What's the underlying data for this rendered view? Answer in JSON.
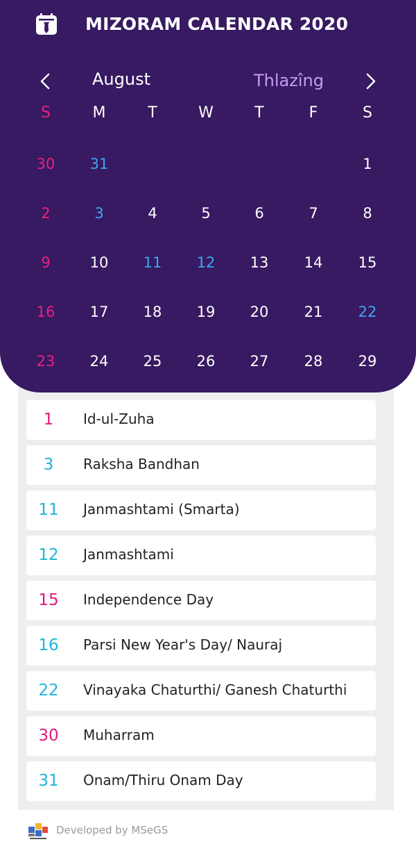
{
  "header": {
    "title": "MIZORAM CALENDAR 2020",
    "icon": "calendar-app-icon"
  },
  "nav": {
    "month": "August",
    "mizo_month": "Thlazîng",
    "prev_icon": "chevron-left-icon",
    "next_icon": "chevron-right-icon"
  },
  "weekdays": [
    "S",
    "M",
    "T",
    "W",
    "T",
    "F",
    "S"
  ],
  "weeks": [
    [
      {
        "d": "30",
        "t": "sunday"
      },
      {
        "d": "31",
        "t": "holiday"
      },
      null,
      null,
      null,
      null,
      {
        "d": "1",
        "t": "normal"
      }
    ],
    [
      {
        "d": "2",
        "t": "sunday"
      },
      {
        "d": "3",
        "t": "holiday"
      },
      {
        "d": "4",
        "t": "normal"
      },
      {
        "d": "5",
        "t": "normal"
      },
      {
        "d": "6",
        "t": "normal"
      },
      {
        "d": "7",
        "t": "normal"
      },
      {
        "d": "8",
        "t": "normal"
      }
    ],
    [
      {
        "d": "9",
        "t": "sunday"
      },
      {
        "d": "10",
        "t": "normal"
      },
      {
        "d": "11",
        "t": "holiday"
      },
      {
        "d": "12",
        "t": "holiday"
      },
      {
        "d": "13",
        "t": "normal"
      },
      {
        "d": "14",
        "t": "normal"
      },
      {
        "d": "15",
        "t": "normal"
      }
    ],
    [
      {
        "d": "16",
        "t": "sunday"
      },
      {
        "d": "17",
        "t": "normal"
      },
      {
        "d": "18",
        "t": "normal"
      },
      {
        "d": "19",
        "t": "normal"
      },
      {
        "d": "20",
        "t": "normal"
      },
      {
        "d": "21",
        "t": "normal"
      },
      {
        "d": "22",
        "t": "holiday"
      }
    ],
    [
      {
        "d": "23",
        "t": "sunday"
      },
      {
        "d": "24",
        "t": "normal"
      },
      {
        "d": "25",
        "t": "normal"
      },
      {
        "d": "26",
        "t": "normal"
      },
      {
        "d": "27",
        "t": "normal"
      },
      {
        "d": "28",
        "t": "normal"
      },
      {
        "d": "29",
        "t": "normal"
      }
    ]
  ],
  "holidays": [
    {
      "day": "1",
      "name": "Id-ul-Zuha",
      "color": "#e3177a"
    },
    {
      "day": "3",
      "name": "Raksha Bandhan",
      "color": "#1fb5d6"
    },
    {
      "day": "11",
      "name": "Janmashtami (Smarta)",
      "color": "#1fb5d6"
    },
    {
      "day": "12",
      "name": "Janmashtami",
      "color": "#1fb5d6"
    },
    {
      "day": "15",
      "name": "Independence Day",
      "color": "#e3177a"
    },
    {
      "day": "16",
      "name": "Parsi New Year's Day/ Nauraj",
      "color": "#1fb5d6"
    },
    {
      "day": "22",
      "name": "Vinayaka Chaturthi/ Ganesh Chaturthi",
      "color": "#1fb5d6"
    },
    {
      "day": "30",
      "name": "Muharram",
      "color": "#e3177a"
    },
    {
      "day": "31",
      "name": "Onam/Thiru Onam Day",
      "color": "#1fb5d6"
    }
  ],
  "footer": {
    "text": "Developed by MSeGS",
    "logo_icon": "msegs-logo-icon"
  },
  "colors": {
    "panel_background": "#371a61",
    "sunday": "#e9217e",
    "holiday": "#3ea6f5",
    "mizo_month": "#c59cf2",
    "list_background": "#eeeeee"
  }
}
